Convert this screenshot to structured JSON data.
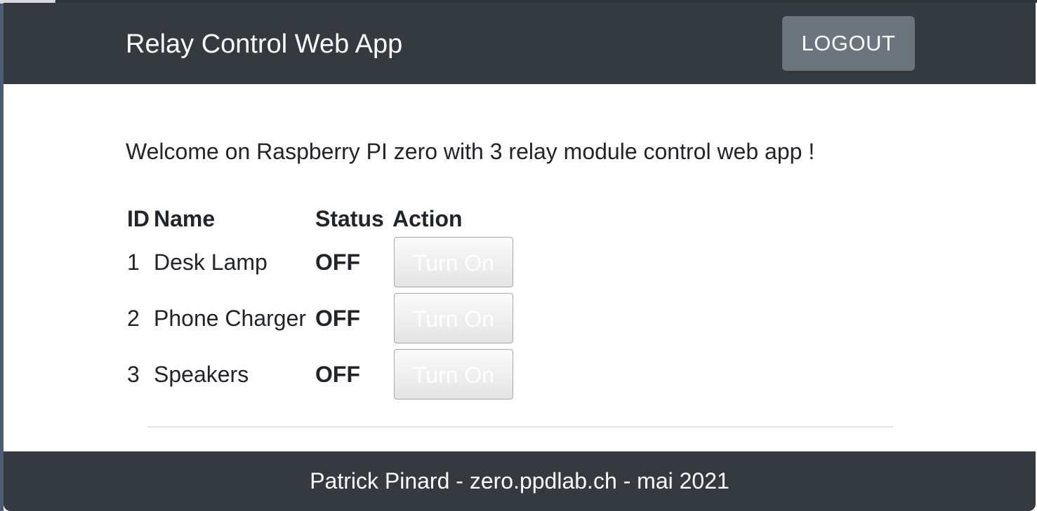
{
  "navbar": {
    "brand": "Relay Control Web App",
    "logout_label": "LOGOUT"
  },
  "main": {
    "welcome": "Welcome on Raspberry PI zero with 3 relay module control web app !",
    "table": {
      "headers": [
        "ID",
        "Name",
        "Status",
        "Action"
      ],
      "rows": [
        {
          "id": "1",
          "name": "Desk Lamp",
          "status": "OFF",
          "action": "Turn On"
        },
        {
          "id": "2",
          "name": "Phone Charger",
          "status": "OFF",
          "action": "Turn On"
        },
        {
          "id": "3",
          "name": "Speakers",
          "status": "OFF",
          "action": "Turn On"
        }
      ]
    }
  },
  "footer": {
    "text": "Patrick Pinard - zero.ppdlab.ch - mai 2021"
  },
  "colors": {
    "navbar_bg": "#343a40",
    "logout_bg": "#6c757d",
    "text": "#212529"
  }
}
